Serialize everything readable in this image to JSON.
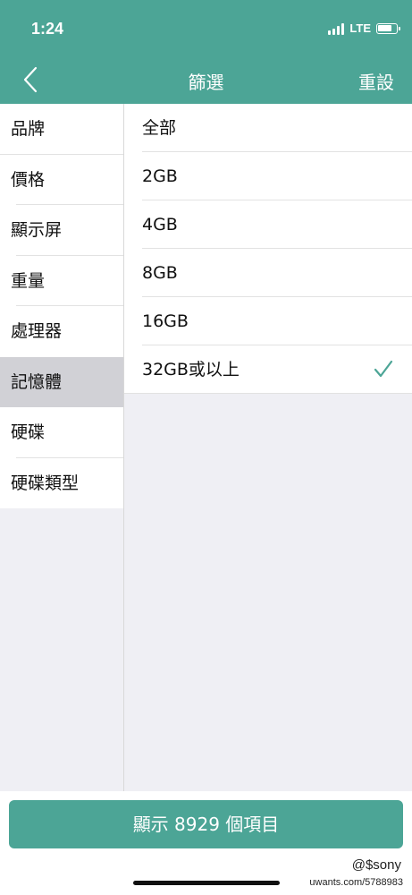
{
  "status": {
    "time": "1:24",
    "network": "LTE"
  },
  "header": {
    "title": "篩選",
    "reset_label": "重設"
  },
  "sidebar": {
    "items": [
      {
        "label": "品牌"
      },
      {
        "label": "價格"
      },
      {
        "label": "顯示屏"
      },
      {
        "label": "重量"
      },
      {
        "label": "處理器"
      },
      {
        "label": "記憶體",
        "active": true
      },
      {
        "label": "硬碟"
      },
      {
        "label": "硬碟類型"
      }
    ]
  },
  "options": {
    "items": [
      {
        "label": "全部"
      },
      {
        "label": "2GB"
      },
      {
        "label": "4GB"
      },
      {
        "label": "8GB"
      },
      {
        "label": "16GB"
      },
      {
        "label": "32GB或以上",
        "selected": true
      }
    ]
  },
  "footer": {
    "show_button_label": "顯示 8929 個項目"
  },
  "watermark": {
    "line1": "@$sony",
    "line2": "uwants.com/5788983"
  },
  "colors": {
    "accent": "#4ca596",
    "active_bg": "#d1d1d6",
    "background": "#efeff4"
  }
}
